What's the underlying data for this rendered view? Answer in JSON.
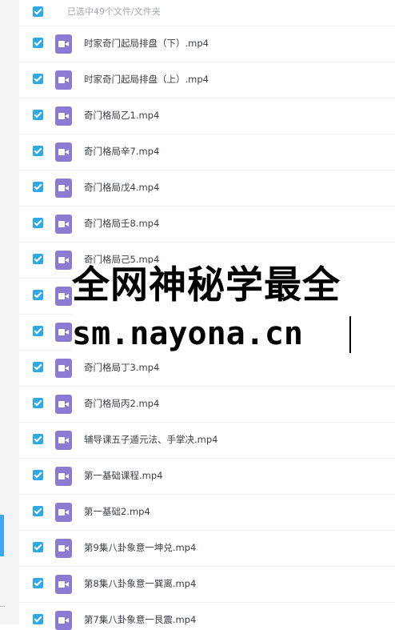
{
  "header": {
    "selection_label": "已选中49个文件/文件夹"
  },
  "files": [
    {
      "name": "时家奇门起局排盘（下）.mp4"
    },
    {
      "name": "时家奇门起局排盘（上）.mp4"
    },
    {
      "name": "奇门格局乙1.mp4"
    },
    {
      "name": "奇门格局辛7.mp4"
    },
    {
      "name": "奇门格局戊4.mp4"
    },
    {
      "name": "奇门格局壬8.mp4"
    },
    {
      "name": "奇门格局己5.mp4"
    },
    {
      "name": ""
    },
    {
      "name": ""
    },
    {
      "name": "奇门格局丁3.mp4"
    },
    {
      "name": "奇门格局丙2.mp4"
    },
    {
      "name": "辅导课五子遁元法、手掌决.mp4"
    },
    {
      "name": "第一基础课程.mp4"
    },
    {
      "name": "第一基础2.mp4"
    },
    {
      "name": "第9集八卦象意一坤兑.mp4"
    },
    {
      "name": "第8集八卦象意一巽离.mp4"
    },
    {
      "name": "第7集八卦象意一艮震.mp4"
    }
  ],
  "watermark": {
    "line1": "全网神秘学最全",
    "line2": "sm.nayona.cn"
  }
}
